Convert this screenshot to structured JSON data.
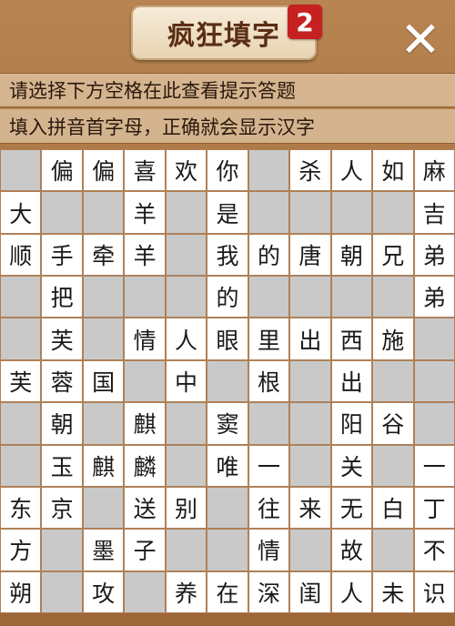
{
  "header": {
    "title": "疯狂填字",
    "level": "2",
    "close_label": "✕"
  },
  "hints": {
    "line1": "请选择下方空格在此查看提示答题",
    "line2": "填入拼音首字母，正确就会显示汉字"
  },
  "grid": {
    "rows": [
      [
        "",
        "偏",
        "偏",
        "喜",
        "欢",
        "你",
        "",
        "杀",
        "人",
        "如",
        "麻"
      ],
      [
        "大",
        "",
        "",
        "羊",
        "",
        "是",
        "",
        "",
        "",
        "",
        "吉"
      ],
      [
        "顺",
        "手",
        "牵",
        "羊",
        "",
        "我",
        "的",
        "唐",
        "朝",
        "兄",
        "弟"
      ],
      [
        "",
        "把",
        "",
        "",
        "",
        "的",
        "",
        "",
        "",
        "",
        "弟"
      ],
      [
        "",
        "芙",
        "",
        "情",
        "人",
        "眼",
        "里",
        "出",
        "西",
        "施",
        ""
      ],
      [
        "芙",
        "蓉",
        "国",
        "",
        "中",
        "",
        "根",
        "",
        "出",
        "",
        ""
      ],
      [
        "",
        "朝",
        "",
        "麒",
        "",
        "窦",
        "",
        "",
        "阳",
        "谷",
        ""
      ],
      [
        "",
        "玉",
        "麒",
        "麟",
        "",
        "唯",
        "一",
        "",
        "关",
        "",
        "一"
      ],
      [
        "东",
        "京",
        "",
        "送",
        "别",
        "",
        "往",
        "来",
        "无",
        "白",
        "丁"
      ],
      [
        "方",
        "",
        "墨",
        "子",
        "",
        "",
        "情",
        "",
        "故",
        "",
        "不"
      ],
      [
        "朔",
        "",
        "攻",
        "",
        "养",
        "在",
        "深",
        "闺",
        "人",
        "未",
        "识"
      ]
    ],
    "shaded": [
      [
        1,
        0,
        0,
        0,
        0,
        0,
        1,
        0,
        0,
        0,
        0
      ],
      [
        0,
        1,
        1,
        0,
        1,
        0,
        1,
        1,
        1,
        1,
        0
      ],
      [
        0,
        0,
        0,
        0,
        1,
        0,
        0,
        0,
        0,
        0,
        0
      ],
      [
        1,
        0,
        1,
        1,
        1,
        0,
        1,
        1,
        1,
        1,
        0
      ],
      [
        1,
        0,
        1,
        0,
        0,
        0,
        0,
        0,
        0,
        0,
        1
      ],
      [
        0,
        0,
        0,
        1,
        0,
        1,
        0,
        1,
        0,
        1,
        1
      ],
      [
        1,
        0,
        1,
        0,
        1,
        0,
        1,
        1,
        0,
        0,
        1
      ],
      [
        1,
        0,
        0,
        0,
        1,
        0,
        0,
        1,
        0,
        1,
        0
      ],
      [
        0,
        0,
        1,
        0,
        0,
        1,
        0,
        0,
        0,
        0,
        0
      ],
      [
        0,
        1,
        0,
        0,
        1,
        1,
        0,
        1,
        0,
        1,
        0
      ],
      [
        0,
        1,
        0,
        1,
        0,
        0,
        0,
        0,
        0,
        0,
        0
      ]
    ]
  },
  "colors": {
    "board_bg": "#b88552",
    "cell_empty": "#ffffff",
    "cell_shaded": "#c9c9c9",
    "badge": "#c62020"
  }
}
